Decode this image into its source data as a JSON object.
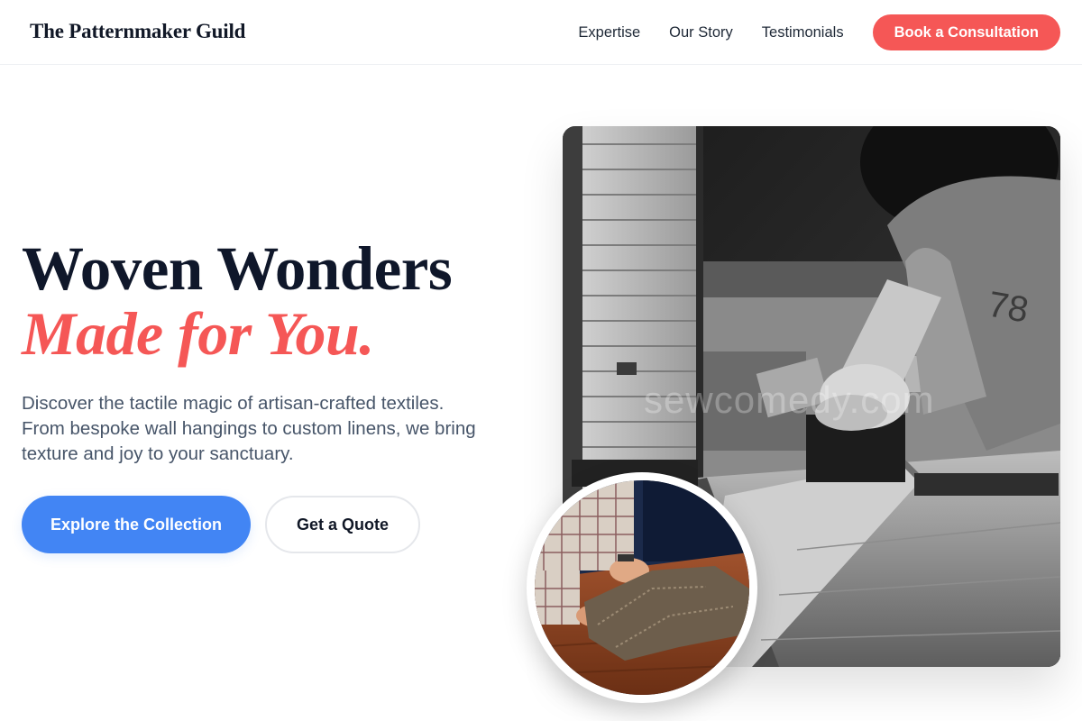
{
  "header": {
    "brand": "The Patternmaker Guild",
    "nav": [
      {
        "label": "Expertise"
      },
      {
        "label": "Our Story"
      },
      {
        "label": "Testimonials"
      }
    ],
    "cta_label": "Book a Consultation"
  },
  "hero": {
    "title_line1": "Woven Wonders",
    "title_line2": "Made for You.",
    "description": "Discover the tactile magic of artisan-crafted textiles. From bespoke wall hangings to custom linens, we bring texture and joy to your sanctuary.",
    "primary_button": "Explore the Collection",
    "secondary_button": "Get a Quote"
  },
  "images": {
    "main_photo_watermark": "sewcomedy.com",
    "main_photo_subject": "craftsman working at a wooden workbench (black and white)",
    "round_photo_subject": "hands stitching tweed fabric on a wooden table"
  },
  "colors": {
    "accent_coral": "#f55756",
    "primary_blue": "#4285f4",
    "heading_dark": "#0f172a",
    "body_gray": "#475569"
  }
}
